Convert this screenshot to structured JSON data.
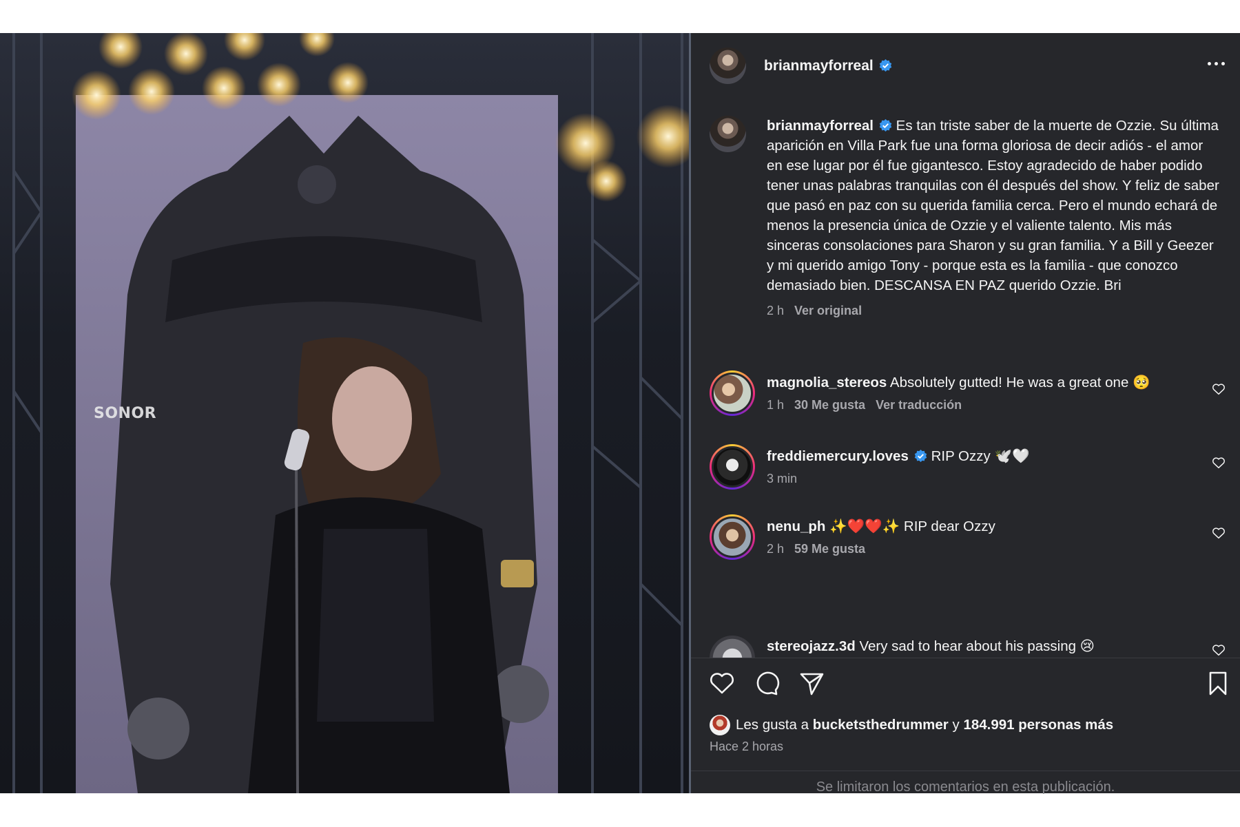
{
  "post": {
    "username": "brianmayforreal",
    "screen_text": "SONOR",
    "caption": {
      "username": "brianmayforreal",
      "text": "Es tan triste saber de la muerte de Ozzie. Su última aparición en Villa Park fue una forma gloriosa de decir adiós - el amor en ese lugar por él fue gigantesco. Estoy agradecido de haber podido tener unas palabras tranquilas con él después del show. Y feliz de saber que pasó en paz con su querida familia cerca. Pero el mundo echará de menos la presencia única de Ozzie y el valiente talento. Mis más sinceras consolaciones para Sharon y su gran familia. Y a Bill y Geezer y mi querido amigo Tony - porque esta es la familia - que conozco demasiado bien. DESCANSA EN PAZ querido Ozzie. Bri",
      "time": "2 h",
      "see_original": "Ver original"
    },
    "comments": [
      {
        "username": "magnolia_stereos",
        "text": "Absolutely gutted! He was a great one 🥺",
        "time": "1 h",
        "likes": "30 Me gusta",
        "translate": "Ver traducción"
      },
      {
        "username": "freddiemercury.loves",
        "text": "RIP Ozzy 🕊️🤍",
        "time": "3 min"
      },
      {
        "username": "nenu_ph",
        "text": "✨❤️❤️✨ RIP dear Ozzy",
        "time": "2 h",
        "likes": "59 Me gusta"
      },
      {
        "username": "stereojazz.3d",
        "text": "Very sad to hear about his passing 😢"
      }
    ],
    "likes": {
      "prefix": "Les gusta a",
      "user": "bucketsthedrummer",
      "connector": "y",
      "others": "184.991 personas más"
    },
    "time_ago": "Hace 2 horas",
    "comments_limited": "Se limitaron los comentarios en esta publicación."
  },
  "colors": {
    "panel_bg": "#26272b",
    "verified": "#3897f0",
    "secondary_text": "#a8a8ad"
  },
  "icons": [
    "verified-badge-icon",
    "more-options-icon",
    "heart-icon",
    "comment-icon",
    "share-icon",
    "bookmark-icon"
  ]
}
